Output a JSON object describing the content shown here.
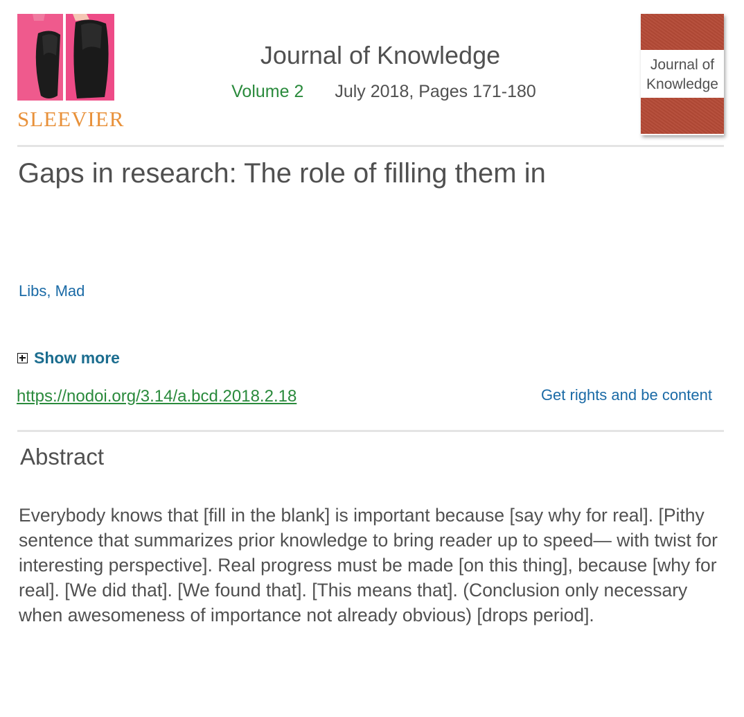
{
  "publisher": {
    "logo_text": "SLEEVIER"
  },
  "journal": {
    "title": "Journal of Knowledge",
    "volume": "Volume 2",
    "issue_info": "July 2018, Pages 171-180",
    "cover_title": "Journal of Knowledge"
  },
  "article": {
    "title": "Gaps in research: The role of filling them in",
    "authors": "Libs, Mad",
    "show_more_label": "Show more",
    "doi": "https://nodoi.org/3.14/a.bcd.2018.2.18",
    "rights_label": "Get rights and be content"
  },
  "abstract": {
    "heading": "Abstract",
    "text": "Everybody knows that [fill in the blank] is important because [say why for real]. [Pithy sentence that summarizes prior knowledge to bring reader up to speed— with twist for interesting perspective]. Real progress must be made [on this thing], because [why for real]. [We did that]. [We found that]. [This means that]. (Conclusion only necessary when awesomeness of importance not already obvious) [drops period]."
  },
  "colors": {
    "text": "#505050",
    "link_blue": "#1a6aa6",
    "link_green": "#2a8a3c",
    "logo_orange": "#e8913a",
    "cover_red": "#b44a36",
    "divider": "#e4e4e4"
  }
}
